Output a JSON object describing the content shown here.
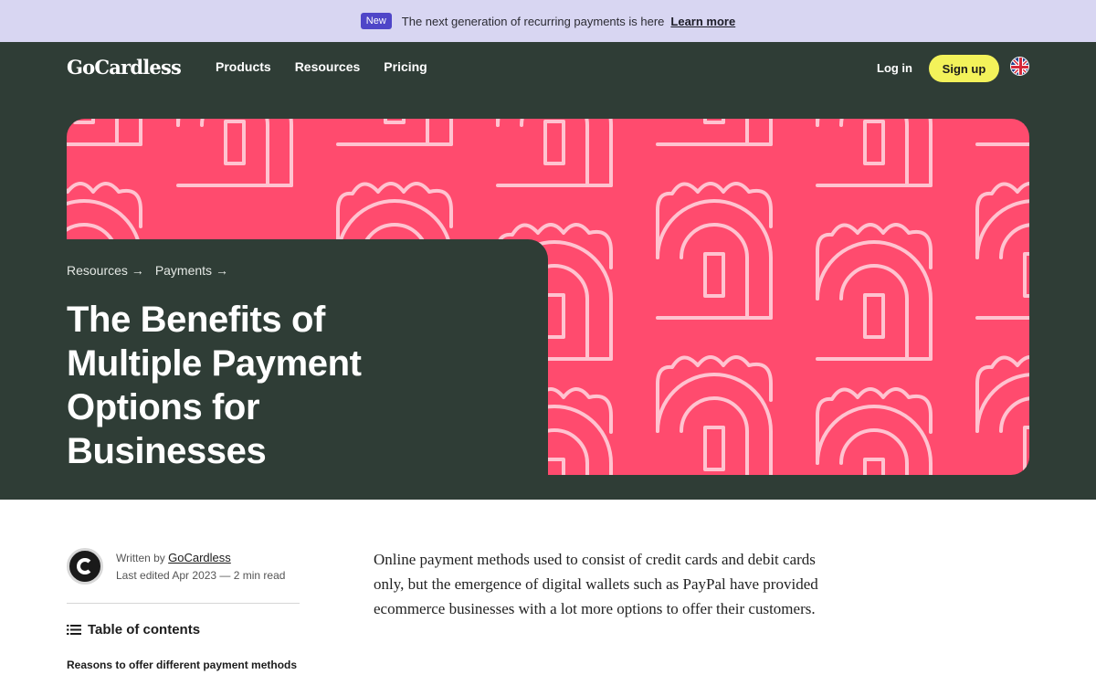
{
  "announcement": {
    "badge": "New",
    "text": "The next generation of recurring payments is here",
    "link": "Learn more"
  },
  "nav": {
    "logo": "GoCardless",
    "links": [
      "Products",
      "Resources",
      "Pricing"
    ],
    "login": "Log in",
    "signup": "Sign up",
    "language_icon": "uk-flag-icon"
  },
  "hero": {
    "breadcrumbs": [
      "Resources →",
      "Payments →"
    ],
    "title": "The Benefits of Multiple Payment Options for Businesses"
  },
  "author": {
    "written_by": "Written by",
    "name": "GoCardless",
    "last_edited": "Last edited Apr 2023 — 2 min read"
  },
  "toc": {
    "title": "Table of contents",
    "items": [
      "Reasons to offer different payment methods"
    ]
  },
  "article": {
    "intro": "Online payment methods used to consist of credit cards and debit cards only, but the emergence of digital wallets such as PayPal have provided ecommerce businesses with a lot more options to offer their customers."
  },
  "colors": {
    "announcement_bg": "#d8d6f2",
    "badge_bg": "#4f46c8",
    "header_bg": "#2f3d36",
    "hero_pink": "#ff4b6e",
    "hero_line": "#ffc3d0",
    "signup_bg": "#f3f25a"
  }
}
